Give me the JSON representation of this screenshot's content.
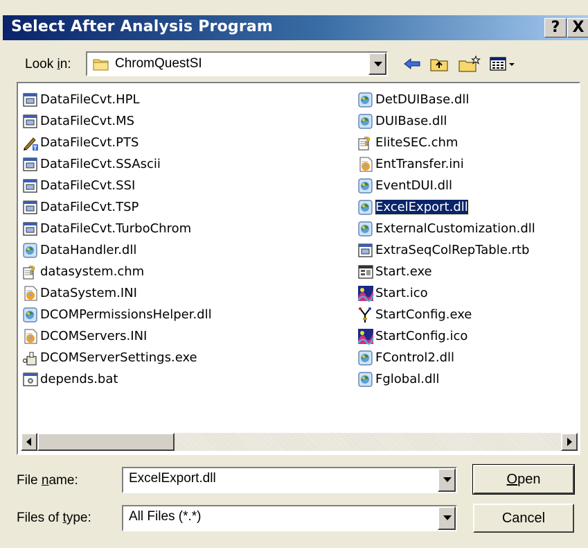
{
  "dialog": {
    "title": "Select After Analysis Program",
    "help_label": "?",
    "close_label": "X"
  },
  "lookin": {
    "label_pre": "Look ",
    "label_u": "i",
    "label_post": "n:",
    "value": "ChromQuestSI",
    "tools": [
      "back-icon",
      "up-folder-icon",
      "new-folder-icon",
      "view-menu-icon"
    ]
  },
  "files": {
    "left": [
      {
        "name": "DataFileCvt.HPL",
        "icon": "window-file-icon"
      },
      {
        "name": "DataFileCvt.MS",
        "icon": "window-file-icon"
      },
      {
        "name": "DataFileCvt.PTS",
        "icon": "pen-file-icon"
      },
      {
        "name": "DataFileCvt.SSAscii",
        "icon": "window-file-icon"
      },
      {
        "name": "DataFileCvt.SSI",
        "icon": "window-file-icon"
      },
      {
        "name": "DataFileCvt.TSP",
        "icon": "window-file-icon"
      },
      {
        "name": "DataFileCvt.TurboChrom",
        "icon": "window-file-icon"
      },
      {
        "name": "DataHandler.dll",
        "icon": "dll-icon"
      },
      {
        "name": "datasystem.chm",
        "icon": "help-file-icon"
      },
      {
        "name": "DataSystem.INI",
        "icon": "ini-icon"
      },
      {
        "name": "DCOMPermissionsHelper.dll",
        "icon": "dll-icon"
      },
      {
        "name": "DCOMServers.INI",
        "icon": "ini-icon"
      },
      {
        "name": "DCOMServerSettings.exe",
        "icon": "exe-icon"
      },
      {
        "name": "depends.bat",
        "icon": "bat-icon"
      }
    ],
    "right": [
      {
        "name": "DetDUIBase.dll",
        "icon": "dll-icon"
      },
      {
        "name": "DUIBase.dll",
        "icon": "dll-icon"
      },
      {
        "name": "EliteSEC.chm",
        "icon": "help-file-icon"
      },
      {
        "name": "EntTransfer.ini",
        "icon": "ini-icon"
      },
      {
        "name": "EventDUI.dll",
        "icon": "dll-icon"
      },
      {
        "name": "ExcelExport.dll",
        "icon": "dll-icon",
        "selected": true
      },
      {
        "name": "ExternalCustomization.dll",
        "icon": "dll-icon"
      },
      {
        "name": "ExtraSeqColRepTable.rtb",
        "icon": "window-file-icon"
      },
      {
        "name": "Start.exe",
        "icon": "app-exe-icon"
      },
      {
        "name": "Start.ico",
        "icon": "image-icon"
      },
      {
        "name": "StartConfig.exe",
        "icon": "config-exe-icon"
      },
      {
        "name": "StartConfig.ico",
        "icon": "image-icon"
      },
      {
        "name": "FControl2.dll",
        "icon": "dll-icon"
      },
      {
        "name": "Fglobal.dll",
        "icon": "dll-icon"
      }
    ]
  },
  "filename": {
    "label_pre": "File ",
    "label_u": "n",
    "label_post": "ame:",
    "value": "ExcelExport.dll"
  },
  "filetype": {
    "label_pre": "Files of ",
    "label_u": "t",
    "label_post": "ype:",
    "value": "All Files (*.*)"
  },
  "buttons": {
    "open_u": "O",
    "open_rest": "pen",
    "cancel": "Cancel"
  }
}
